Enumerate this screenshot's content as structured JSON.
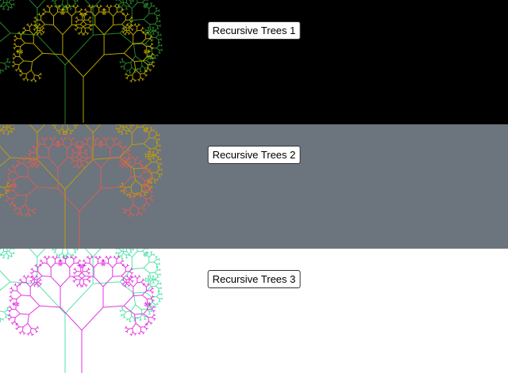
{
  "panels": [
    {
      "button_label": "Recursive Trees 1",
      "background": "#000000",
      "tree_colors": [
        "#2f8f2f",
        "#c8b400"
      ]
    },
    {
      "button_label": "Recursive Trees 2",
      "background": "#6c747e",
      "tree_colors": [
        "#c8a000",
        "#e06050"
      ]
    },
    {
      "button_label": "Recursive Trees 3",
      "background": "#ffffff",
      "tree_colors": [
        "#40e0a0",
        "#e020e0"
      ]
    }
  ]
}
